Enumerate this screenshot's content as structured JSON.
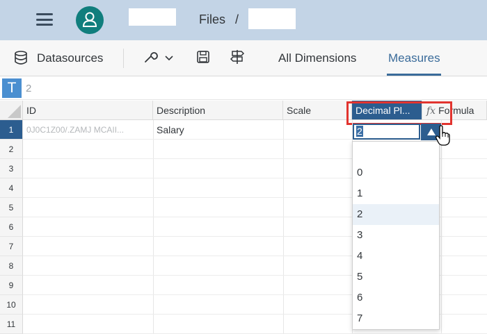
{
  "shell": {
    "breadcrumb_files": "Files",
    "breadcrumb_sep": "/",
    "menu_icon": "hamburger-menu-icon",
    "avatar_icon": "user-icon"
  },
  "toolbar": {
    "datasources_label": "Datasources",
    "tabs": [
      {
        "label": "All Dimensions",
        "active": false
      },
      {
        "label": "Measures",
        "active": true
      }
    ],
    "icons": [
      "database-icon",
      "wrench-icon",
      "chevron-down-icon",
      "save-icon",
      "signpost-icon"
    ],
    "accent_color": "#3a6b9a"
  },
  "formula_bar": {
    "type_button": "T",
    "value": "2"
  },
  "grid": {
    "columns": [
      "ID",
      "Description",
      "Scale",
      "Decimal Pl...",
      "Formula"
    ],
    "formula_icon": "fx",
    "rows": [
      "1",
      "2",
      "3",
      "4",
      "5",
      "6",
      "7",
      "8",
      "9",
      "10",
      "11"
    ],
    "row1": {
      "id": "0J0C1Z00/.ZAMJ MCAII...",
      "description": "Salary",
      "scale": "",
      "decimal": "2"
    },
    "header_selected_color": "#2c5d8f",
    "highlight_color": "#e2342f"
  },
  "dropdown": {
    "options": [
      "",
      "0",
      "1",
      "2",
      "3",
      "4",
      "5",
      "6",
      "7"
    ],
    "selected": "2"
  }
}
